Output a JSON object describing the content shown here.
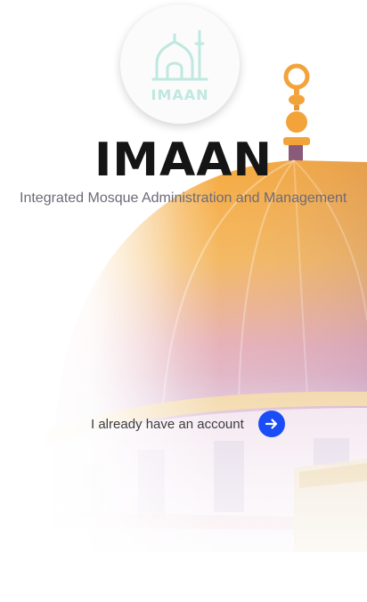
{
  "logo": {
    "icon": "mosque-icon",
    "wordmark": "IMAAN"
  },
  "app": {
    "title": "IMAAN",
    "subtitle": "Integrated Mosque Administration and Management"
  },
  "actions": {
    "existing_account_label": "I already have an account",
    "existing_account_icon": "arrow-right-icon"
  },
  "colors": {
    "accent": "#1a4df5",
    "dome_gold": "#f2a33a",
    "logo_teal": "#bfe8e0",
    "title": "#151515"
  }
}
